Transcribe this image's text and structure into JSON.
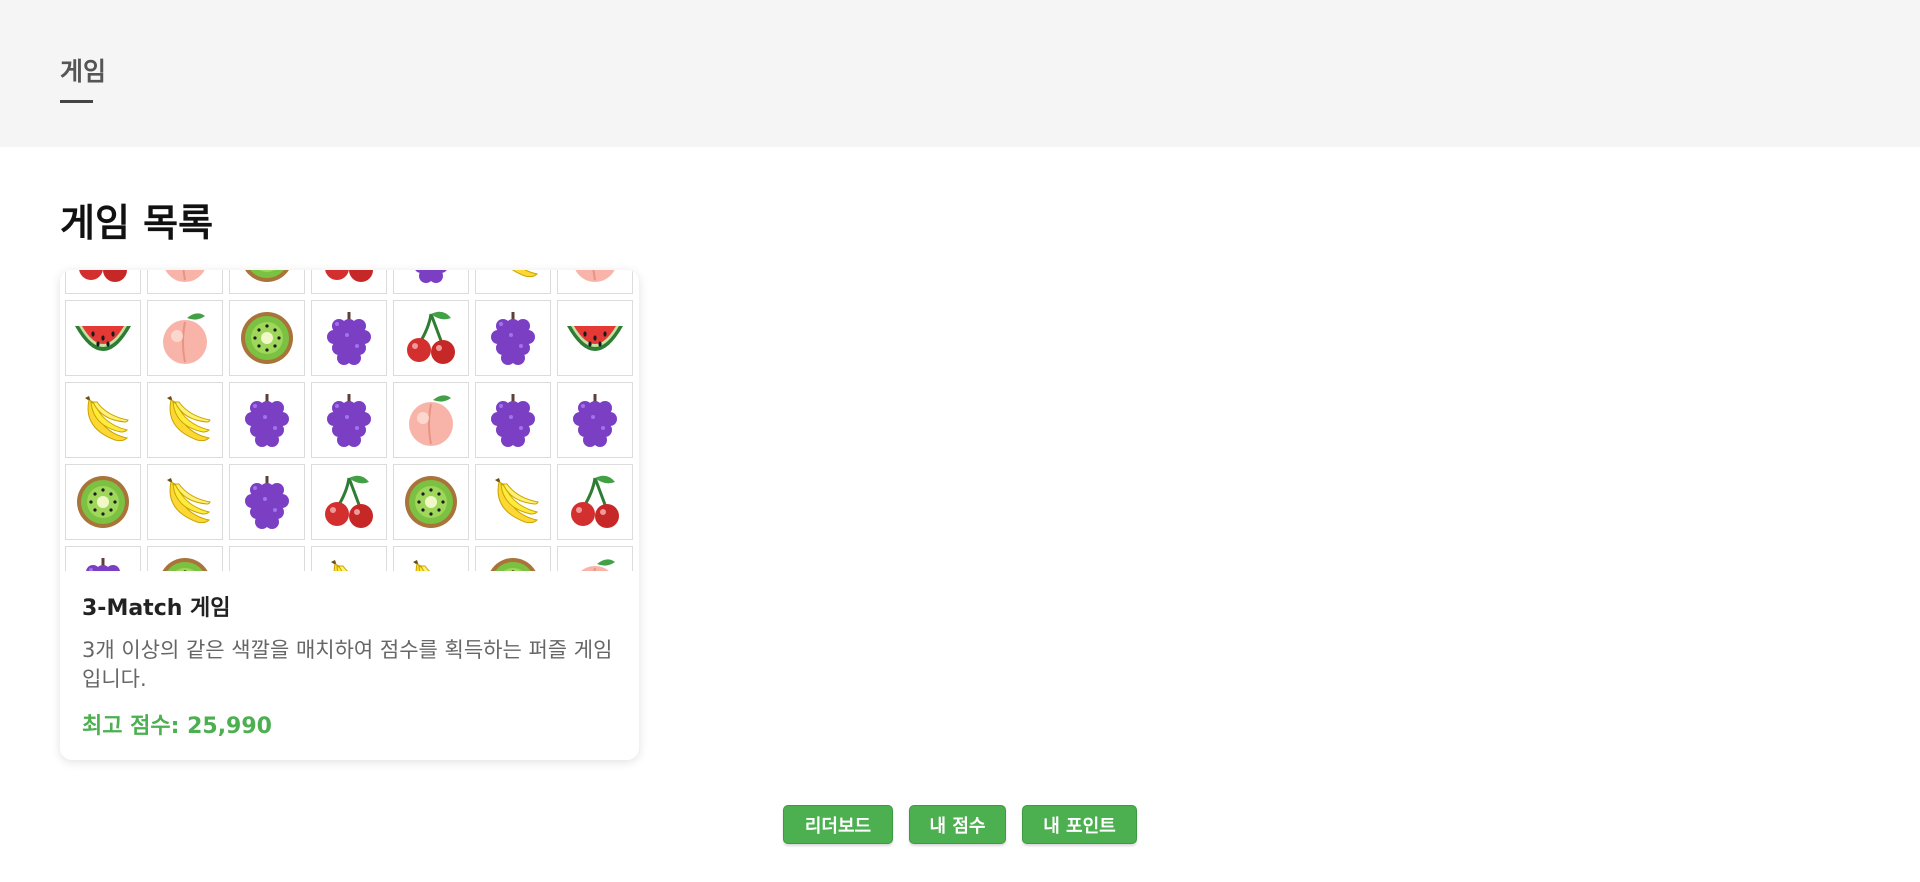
{
  "header": {
    "title": "게임"
  },
  "main": {
    "section_title": "게임 목록"
  },
  "game_card": {
    "title": "3-Match 게임",
    "description": "3개 이상의 같은 색깔을 매치하여 점수를 획득하는 퍼즐 게임입니다.",
    "best_score": "최고 점수: 25,990",
    "board": [
      [
        "cherry",
        "peach",
        "kiwi",
        "cherry",
        "grape",
        "banana",
        "peach"
      ],
      [
        "watermelon",
        "peach",
        "kiwi",
        "grape",
        "cherry",
        "grape",
        "watermelon"
      ],
      [
        "banana",
        "banana",
        "grape",
        "grape",
        "peach",
        "grape",
        "grape"
      ],
      [
        "kiwi",
        "banana",
        "grape",
        "cherry",
        "kiwi",
        "banana",
        "cherry"
      ],
      [
        "grape",
        "kiwi",
        "empty",
        "banana",
        "banana",
        "kiwi",
        "peach"
      ]
    ]
  },
  "buttons": {
    "leaderboard": "리더보드",
    "my_score": "내 점수",
    "my_points": "내 포인트"
  },
  "colors": {
    "accent_green": "#4caf50",
    "header_bg": "#f5f5f5"
  }
}
